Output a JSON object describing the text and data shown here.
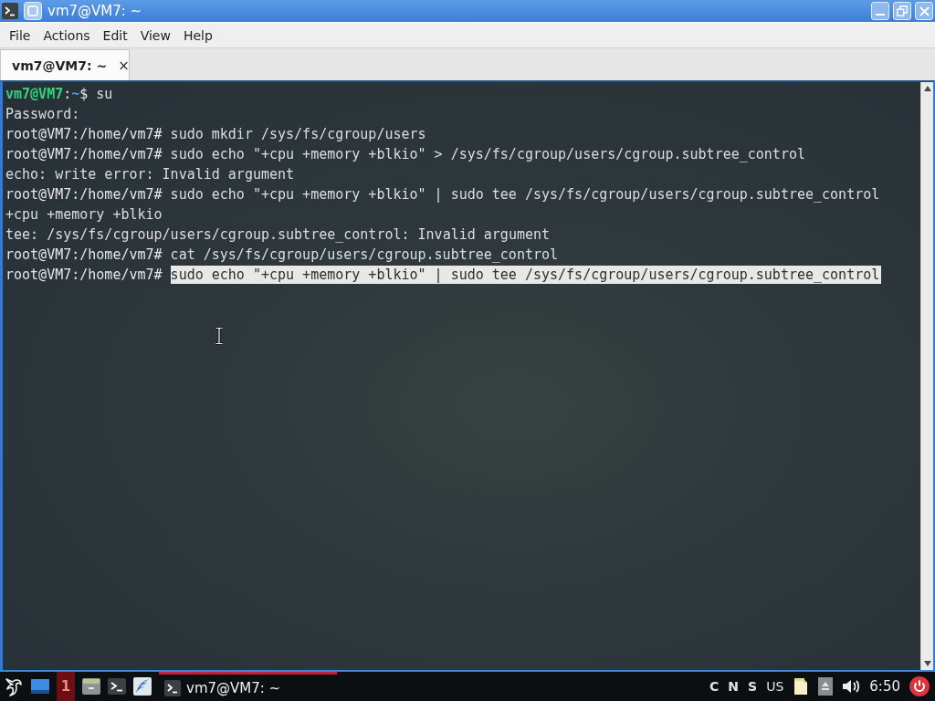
{
  "window": {
    "title": "vm7@VM7: ~"
  },
  "menu": [
    "File",
    "Actions",
    "Edit",
    "View",
    "Help"
  ],
  "tabs": [
    {
      "label": "vm7@VM7: ~",
      "close": "×",
      "selected": true
    }
  ],
  "terminal": {
    "lines": [
      {
        "kind": "prompt",
        "segments": [
          {
            "kind": "user",
            "text": "vm7@VM7"
          },
          {
            "kind": "plain",
            "text": ":"
          },
          {
            "kind": "path",
            "text": "~"
          },
          {
            "kind": "plain",
            "text": "$"
          }
        ],
        "command": "su",
        "selected": false
      },
      {
        "kind": "output",
        "text": "Password:"
      },
      {
        "kind": "prompt",
        "segments": [
          {
            "kind": "plain",
            "text": "root@VM7:/home/vm7#"
          }
        ],
        "command": "sudo mkdir /sys/fs/cgroup/users",
        "selected": false
      },
      {
        "kind": "prompt",
        "segments": [
          {
            "kind": "plain",
            "text": "root@VM7:/home/vm7#"
          }
        ],
        "command": "sudo echo \"+cpu +memory +blkio\" > /sys/fs/cgroup/users/cgroup.subtree_control",
        "selected": false
      },
      {
        "kind": "output",
        "text": "echo: write error: Invalid argument"
      },
      {
        "kind": "prompt",
        "segments": [
          {
            "kind": "plain",
            "text": "root@VM7:/home/vm7#"
          }
        ],
        "command": "sudo echo \"+cpu +memory +blkio\" | sudo tee /sys/fs/cgroup/users/cgroup.subtree_control",
        "selected": false
      },
      {
        "kind": "output",
        "text": "+cpu +memory +blkio"
      },
      {
        "kind": "output",
        "text": "tee: /sys/fs/cgroup/users/cgroup.subtree_control: Invalid argument"
      },
      {
        "kind": "prompt",
        "segments": [
          {
            "kind": "plain",
            "text": "root@VM7:/home/vm7#"
          }
        ],
        "command": "cat /sys/fs/cgroup/users/cgroup.subtree_control",
        "selected": false
      },
      {
        "kind": "prompt",
        "segments": [
          {
            "kind": "plain",
            "text": "root@VM7:/home/vm7#"
          }
        ],
        "command": "sudo echo \"+cpu +memory +blkio\" | sudo tee /sys/fs/cgroup/users/cgroup.subtree_control",
        "selected": true
      }
    ]
  },
  "taskbar": {
    "workspace": {
      "label": "1",
      "selected": true
    },
    "tasks": [
      {
        "label": "vm7@VM7: ~",
        "active": true
      }
    ],
    "lock_keys": [
      "C",
      "N",
      "S"
    ],
    "keyboard_layout": "US",
    "clock": "6:50"
  }
}
